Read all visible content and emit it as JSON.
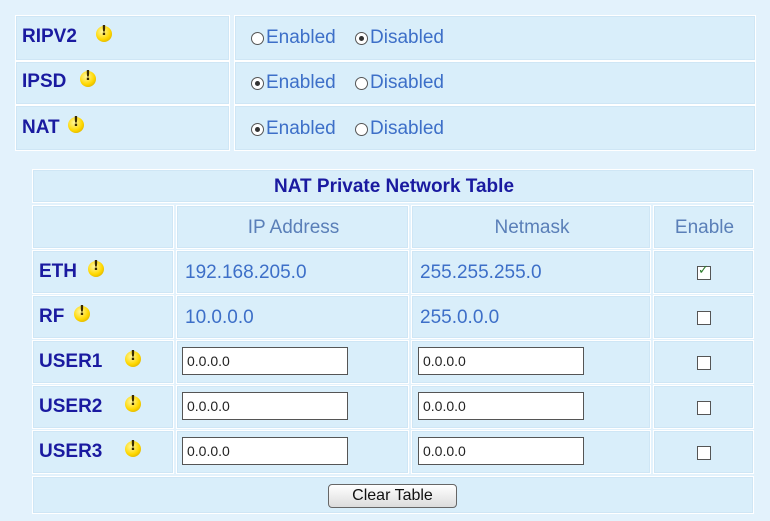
{
  "settings": [
    {
      "label": "RIPV2",
      "options": [
        "Enabled",
        "Disabled"
      ],
      "selected": "Disabled"
    },
    {
      "label": "IPSD",
      "options": [
        "Enabled",
        "Disabled"
      ],
      "selected": "Enabled"
    },
    {
      "label": "NAT",
      "options": [
        "Enabled",
        "Disabled"
      ],
      "selected": "Enabled"
    }
  ],
  "nat_table": {
    "title": "NAT Private Network Table",
    "headers": {
      "ip": "IP Address",
      "netmask": "Netmask",
      "enable": "Enable"
    },
    "rows": [
      {
        "label": "ETH",
        "ip": "192.168.205.0",
        "netmask": "255.255.255.0",
        "enabled": true,
        "editable": false
      },
      {
        "label": "RF",
        "ip": "10.0.0.0",
        "netmask": "255.0.0.0",
        "enabled": false,
        "editable": false
      },
      {
        "label": "USER1",
        "ip": "0.0.0.0",
        "netmask": "0.0.0.0",
        "enabled": false,
        "editable": true
      },
      {
        "label": "USER2",
        "ip": "0.0.0.0",
        "netmask": "0.0.0.0",
        "enabled": false,
        "editable": true
      },
      {
        "label": "USER3",
        "ip": "0.0.0.0",
        "netmask": "0.0.0.0",
        "enabled": false,
        "editable": true
      }
    ],
    "clear_button": "Clear Table"
  }
}
